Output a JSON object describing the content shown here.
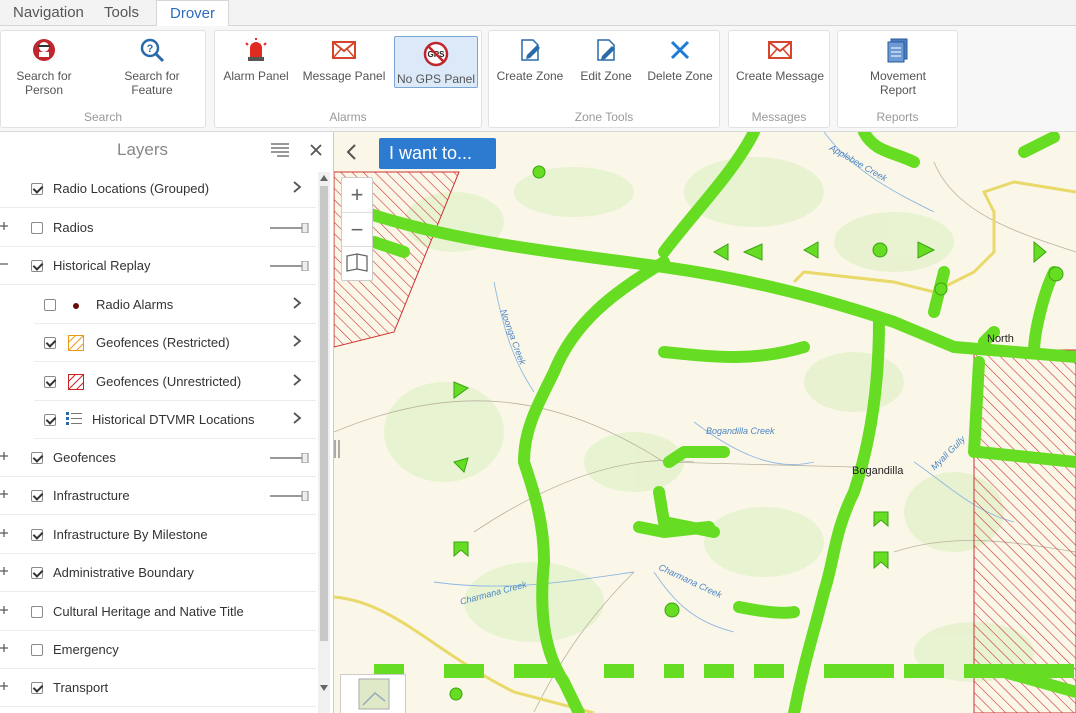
{
  "tabs": [
    {
      "label": "Navigation"
    },
    {
      "label": "Tools"
    },
    {
      "label": "Drover"
    }
  ],
  "ribbon": {
    "groups": [
      {
        "label": "Search",
        "buttons": [
          {
            "label": "Search for Person",
            "icon": "person-search-icon"
          },
          {
            "label": "Search for Feature",
            "icon": "magnifier-question-icon"
          }
        ]
      },
      {
        "label": "Alarms",
        "buttons": [
          {
            "label": "Alarm Panel",
            "icon": "siren-icon"
          },
          {
            "label": "Message Panel",
            "icon": "envelope-icon"
          },
          {
            "label": "No GPS Panel",
            "icon": "no-gps-icon"
          }
        ]
      },
      {
        "label": "Zone Tools",
        "buttons": [
          {
            "label": "Create Zone",
            "icon": "create-zone-icon"
          },
          {
            "label": "Edit Zone",
            "icon": "edit-zone-icon"
          },
          {
            "label": "Delete Zone",
            "icon": "delete-x-icon"
          }
        ]
      },
      {
        "label": "Messages",
        "buttons": [
          {
            "label": "Create Message",
            "icon": "envelope-icon"
          }
        ]
      },
      {
        "label": "Reports",
        "buttons": [
          {
            "label": "Movement Report",
            "icon": "report-icon"
          }
        ]
      }
    ]
  },
  "layers": {
    "title": "Layers",
    "items": [
      {
        "label": "Radio Locations (Grouped)",
        "checked": true
      },
      {
        "label": "Radios",
        "checked": false
      },
      {
        "label": "Historical Replay",
        "checked": true
      },
      {
        "label": "Radio Alarms",
        "checked": false
      },
      {
        "label": "Geofences (Restricted)",
        "checked": true
      },
      {
        "label": "Geofences (Unrestricted)",
        "checked": true
      },
      {
        "label": "Historical DTVMR Locations",
        "checked": true
      },
      {
        "label": "Geofences",
        "checked": true
      },
      {
        "label": "Infrastructure",
        "checked": true
      },
      {
        "label": "Infrastructure By Milestone",
        "checked": true
      },
      {
        "label": "Administrative Boundary",
        "checked": true
      },
      {
        "label": "Cultural Heritage and Native Title",
        "checked": false
      },
      {
        "label": "Emergency",
        "checked": false
      },
      {
        "label": "Transport",
        "checked": true
      }
    ]
  },
  "map": {
    "iwant_label": "I want to...",
    "zoom_in": "+",
    "zoom_out": "−",
    "place_labels": {
      "north": "North",
      "bogandilla": "Bogandilla"
    },
    "creek_labels": {
      "applebee": "Applebee Creek",
      "noonga": "Noonga Creek",
      "bogandilla_creek": "Bogandilla Creek",
      "myall": "Myall Gully",
      "charmana1": "Charmana Creek",
      "charmana2": "Charmana Creek"
    },
    "colors": {
      "track": "#66dd22",
      "track_dark": "#3aa312",
      "road": "#e8d96a",
      "hatch": "#cc3333"
    }
  }
}
